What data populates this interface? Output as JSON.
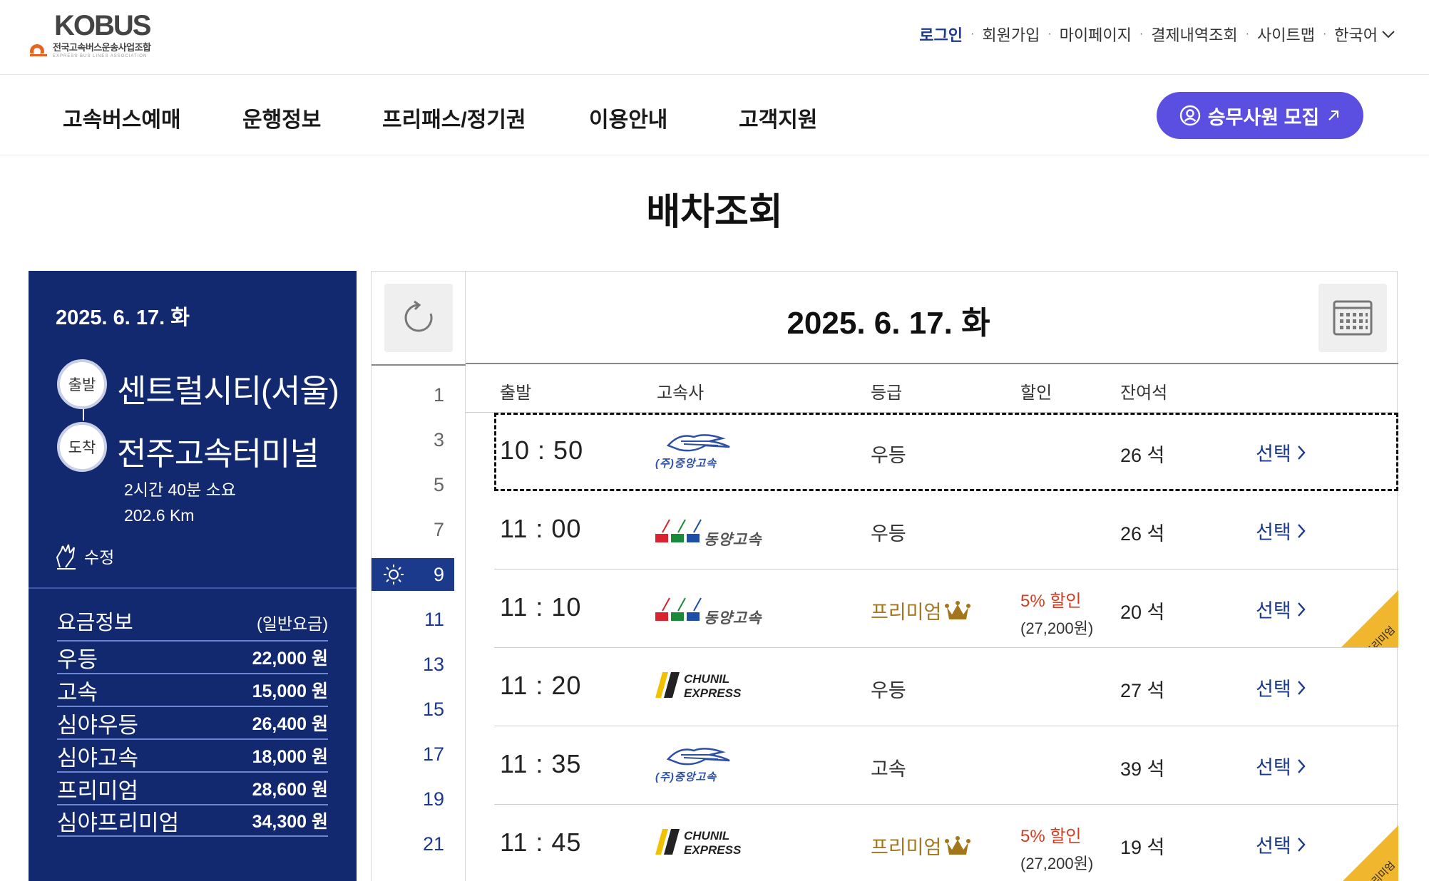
{
  "header": {
    "logo_text": "KOBUS",
    "logo_sub": "전국고속버스운송사업조합",
    "logo_sub_en": "EXPRESS BUS LINES ASSOCIATION",
    "util_links": [
      "로그인",
      "회원가입",
      "마이페이지",
      "결제내역조회",
      "사이트맵"
    ],
    "language": "한국어"
  },
  "gnb": {
    "items": [
      "고속버스예매",
      "운행정보",
      "프리패스/정기권",
      "이용안내",
      "고객지원"
    ],
    "recruit_label": "승무사원 모집"
  },
  "page_title": "배차조회",
  "route": {
    "date": "2025. 6. 17. 화",
    "depart_badge": "출발",
    "depart": "센트럴시티(서울)",
    "arrive_badge": "도착",
    "arrive": "전주고속터미널",
    "duration": "2시간 40분 소요",
    "distance": "202.6 Km",
    "edit_label": "수정"
  },
  "fare": {
    "title": "요금정보",
    "subtitle": "(일반요금)",
    "rows": [
      {
        "grade": "우등",
        "price": "22,000 원"
      },
      {
        "grade": "고속",
        "price": "15,000 원"
      },
      {
        "grade": "심야우등",
        "price": "26,400 원"
      },
      {
        "grade": "심야고속",
        "price": "18,000 원"
      },
      {
        "grade": "프리미엄",
        "price": "28,600 원"
      },
      {
        "grade": "심야프리미엄",
        "price": "34,300 원"
      }
    ]
  },
  "schedule": {
    "date": "2025. 6. 17. 화",
    "hours": [
      "1",
      "3",
      "5",
      "7",
      "9",
      "11",
      "13",
      "15",
      "17",
      "19",
      "21"
    ],
    "active_hour": "9",
    "columns": [
      "출발",
      "고속사",
      "등급",
      "할인",
      "잔여석"
    ],
    "rows": [
      {
        "time": "10 : 50",
        "company": "(주)중앙고속",
        "company_logo": "jungang",
        "grade": "우등",
        "premium": false,
        "discount": "",
        "discount_price": "",
        "seats": "26 석",
        "select": "선택"
      },
      {
        "time": "11 : 00",
        "company": "동양고속",
        "company_logo": "dongyang",
        "grade": "우등",
        "premium": false,
        "discount": "",
        "discount_price": "",
        "seats": "26 석",
        "select": "선택"
      },
      {
        "time": "11 : 10",
        "company": "동양고속",
        "company_logo": "dongyang",
        "grade": "프리미엄",
        "premium": true,
        "discount": "5% 할인",
        "discount_price": "(27,200원)",
        "seats": "20 석",
        "select": "선택",
        "ribbon": "프리미엄"
      },
      {
        "time": "11 : 20",
        "company": "CHUNIL EXPRESS",
        "company_logo": "chunil",
        "grade": "우등",
        "premium": false,
        "discount": "",
        "discount_price": "",
        "seats": "27 석",
        "select": "선택"
      },
      {
        "time": "11 : 35",
        "company": "(주)중앙고속",
        "company_logo": "jungang",
        "grade": "고속",
        "premium": false,
        "discount": "",
        "discount_price": "",
        "seats": "39 석",
        "select": "선택"
      },
      {
        "time": "11 : 45",
        "company": "CHUNIL EXPRESS",
        "company_logo": "chunil",
        "grade": "프리미엄",
        "premium": true,
        "discount": "5% 할인",
        "discount_price": "(27,200원)",
        "seats": "19 석",
        "select": "선택",
        "ribbon": "프리미엄"
      }
    ]
  },
  "colors": {
    "navy": "#13296f",
    "link_blue": "#1b3a8c",
    "recruit_purple": "#5a4fe0",
    "premium_gold": "#a4761b",
    "discount_red": "#d63b1f",
    "ribbon_yellow": "#f0b62e"
  },
  "icons": [
    "refresh-icon",
    "calendar-icon",
    "edit-hand-icon",
    "sun-icon",
    "crown-icon",
    "chevron-right-icon",
    "user-circle-icon",
    "external-arrow-icon",
    "chevron-down-icon"
  ]
}
